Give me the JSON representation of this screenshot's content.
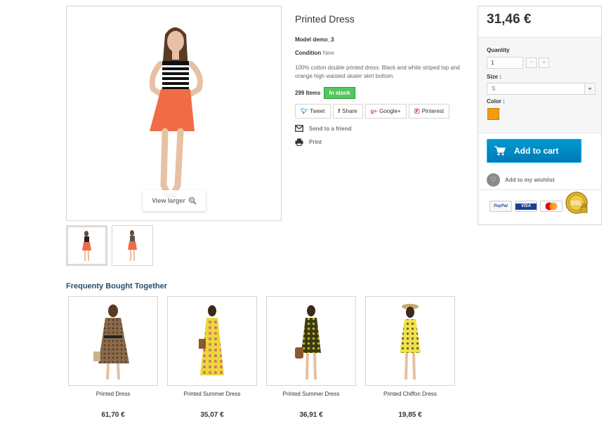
{
  "product": {
    "title": "Printed Dress",
    "model_label": "Model",
    "model_value": "demo_3",
    "condition_label": "Condition",
    "condition_value": "New",
    "description": "100% cotton double printed dress. Black and white striped top and orange high waisted skater skirt bottom.",
    "items_count": "299 Items",
    "stock_status": "In stock",
    "view_larger": "View larger"
  },
  "share": {
    "tweet": "Tweet",
    "share": "Share",
    "google": "Google+",
    "pinterest": "Pinterest"
  },
  "actions": {
    "send_friend": "Send to a friend",
    "print": "Print"
  },
  "buy_box": {
    "price": "31,46 €",
    "quantity_label": "Quantity",
    "quantity_value": "1",
    "minus": "−",
    "plus": "+",
    "size_label": "Size :",
    "size_value": "S",
    "color_label": "Color :",
    "color_value": "#f39c11",
    "add_to_cart": "Add to cart",
    "wishlist": "Add to my wishlist",
    "payment_paypal": "PayPal",
    "payment_visa": "VISA",
    "payment_mastercard": "MasterCard",
    "payment_ssl": "SSL"
  },
  "fbt": {
    "title": "Frequenty Bought Together",
    "items": [
      {
        "name": "Printed Dress",
        "price": "61,70 €"
      },
      {
        "name": "Printed Summer Dress",
        "price": "35,07 €"
      },
      {
        "name": "Printed Summer Dress",
        "price": "36,91 €"
      },
      {
        "name": "Printed Chiffon Dress",
        "price": "19,85 €"
      }
    ]
  },
  "colors": {
    "accent_blue": "#0093cf",
    "in_stock_green": "#55c65e",
    "heading_blue": "#274d6c",
    "swatch_orange": "#f39c11"
  }
}
